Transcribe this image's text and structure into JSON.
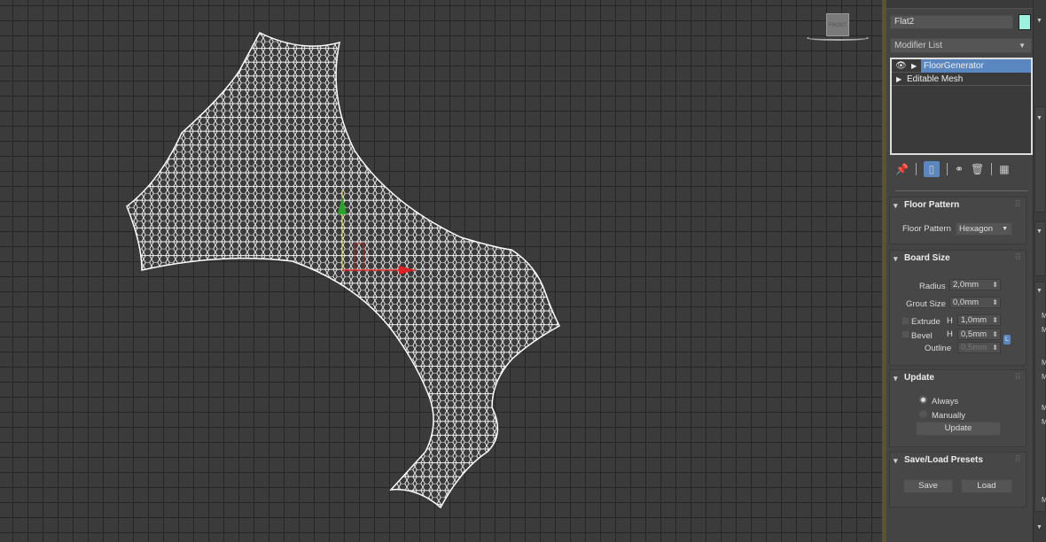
{
  "viewport": {
    "viewcube_label": "FRONT"
  },
  "panel": {
    "object_name": "Flat2",
    "object_color": "#9ef0df",
    "modifier_list": "Modifier List",
    "stack": [
      {
        "label": "FloorGenerator",
        "selected": true
      },
      {
        "label": "Editable Mesh",
        "selected": false
      }
    ],
    "floor_pattern": {
      "title": "Floor Pattern",
      "label": "Floor Pattern",
      "value": "Hexagon"
    },
    "board_size": {
      "title": "Board Size",
      "radius_label": "Radius",
      "radius": "2,0mm",
      "grout_label": "Grout Size",
      "grout": "0,0mm",
      "extrude_label": "Extrude",
      "extrude_h": "H",
      "extrude": "1,0mm",
      "bevel_label": "Bevel",
      "bevel_h": "H",
      "bevel": "0,5mm",
      "lock": "L",
      "outline_label": "Outline",
      "outline": "0,5mm"
    },
    "update": {
      "title": "Update",
      "always": "Always",
      "manually": "Manually",
      "button": "Update"
    },
    "presets": {
      "title": "Save/Load Presets",
      "save": "Save",
      "load": "Load"
    }
  },
  "side": {
    "letters": [
      "M",
      "M",
      "M",
      "M",
      "M",
      "M",
      "M"
    ]
  }
}
